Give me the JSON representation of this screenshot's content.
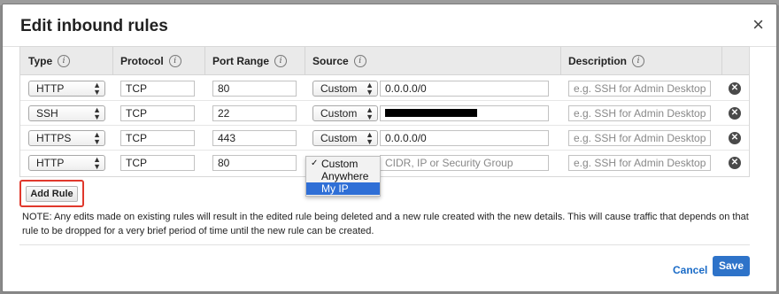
{
  "dialog": {
    "title": "Edit inbound rules",
    "close": "×"
  },
  "columns": {
    "type": "Type",
    "protocol": "Protocol",
    "port_range": "Port Range",
    "source": "Source",
    "description": "Description"
  },
  "rules": [
    {
      "type": "HTTP",
      "protocol": "TCP",
      "port": "80",
      "source_type": "Custom",
      "source_value": "0.0.0.0/0",
      "description_placeholder": "e.g. SSH for Admin Desktop"
    },
    {
      "type": "SSH",
      "protocol": "TCP",
      "port": "22",
      "source_type": "Custom",
      "source_value": "",
      "description_placeholder": "e.g. SSH for Admin Desktop"
    },
    {
      "type": "HTTPS",
      "protocol": "TCP",
      "port": "443",
      "source_type": "Custom",
      "source_value": "0.0.0.0/0",
      "description_placeholder": "e.g. SSH for Admin Desktop"
    },
    {
      "type": "HTTP",
      "protocol": "TCP",
      "port": "80",
      "source_type": "Custom",
      "source_placeholder": "CIDR, IP or Security Group",
      "description_placeholder": "e.g. SSH for Admin Desktop"
    }
  ],
  "source_dropdown": {
    "options": [
      "Custom",
      "Anywhere",
      "My IP"
    ],
    "checked": "Custom",
    "highlighted": "My IP"
  },
  "buttons": {
    "add_rule": "Add Rule",
    "cancel": "Cancel",
    "save": "Save"
  },
  "note": "NOTE: Any edits made on existing rules will result in the edited rule being deleted and a new rule created with the new details. This will cause traffic that depends on that rule to be dropped for a very brief period of time until the new rule can be created.",
  "colors": {
    "accent": "#2e73c9",
    "highlight": "#e0382c"
  }
}
